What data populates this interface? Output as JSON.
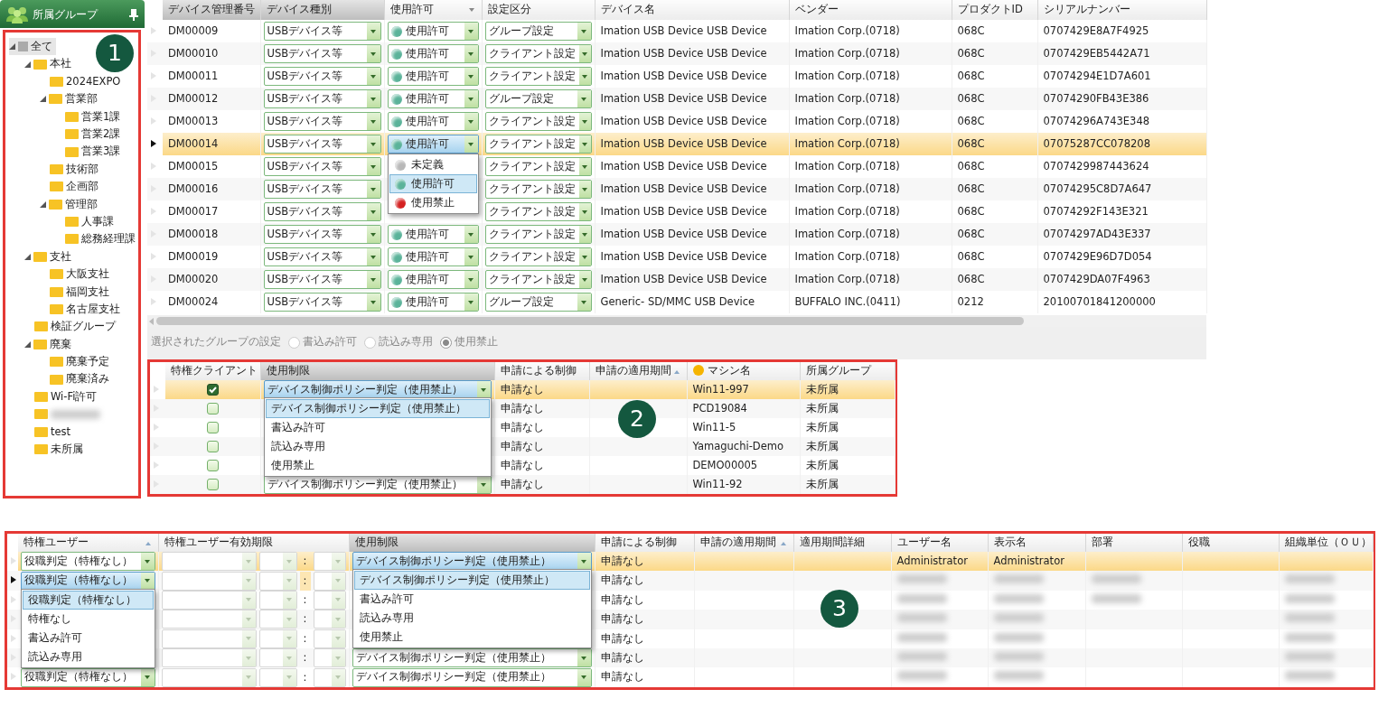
{
  "group_panel": {
    "title": "所属グループ",
    "callout": "1",
    "tree": [
      {
        "kind": "root",
        "label": "全て",
        "selected": true,
        "expanded": true,
        "children": [
          {
            "kind": "folder",
            "label": "本社",
            "expanded": true,
            "children": [
              {
                "kind": "folder",
                "label": "2024EXPO"
              },
              {
                "kind": "folder",
                "label": "営業部",
                "expanded": true,
                "children": [
                  {
                    "kind": "folder",
                    "label": "営業1課"
                  },
                  {
                    "kind": "folder",
                    "label": "営業2課"
                  },
                  {
                    "kind": "folder",
                    "label": "営業3課"
                  }
                ]
              },
              {
                "kind": "folder",
                "label": "技術部"
              },
              {
                "kind": "folder",
                "label": "企画部"
              },
              {
                "kind": "folder",
                "label": "管理部",
                "expanded": true,
                "children": [
                  {
                    "kind": "folder",
                    "label": "人事課"
                  },
                  {
                    "kind": "folder",
                    "label": "総務経理課"
                  }
                ]
              }
            ]
          },
          {
            "kind": "folder",
            "label": "支社",
            "expanded": true,
            "children": [
              {
                "kind": "folder",
                "label": "大阪支社"
              },
              {
                "kind": "folder",
                "label": "福岡支社"
              },
              {
                "kind": "folder",
                "label": "名古屋支社"
              }
            ]
          },
          {
            "kind": "folder",
            "label": "検証グループ"
          },
          {
            "kind": "folder",
            "label": "廃棄",
            "expanded": true,
            "children": [
              {
                "kind": "folder",
                "label": "廃棄予定"
              },
              {
                "kind": "folder",
                "label": "廃棄済み"
              }
            ]
          },
          {
            "kind": "folder",
            "label": "Wi-Fi許可"
          },
          {
            "kind": "folder",
            "redacted": true
          },
          {
            "kind": "folder",
            "label": "test"
          },
          {
            "kind": "folder",
            "label": "未所属"
          }
        ]
      }
    ]
  },
  "device_grid": {
    "columns": [
      {
        "label": "デバイス管理番号",
        "kind": "text",
        "editable": true
      },
      {
        "label": "デバイス種別",
        "kind": "combo",
        "editable": true
      },
      {
        "label": "使用許可",
        "kind": "status",
        "sorted": true,
        "descending": true
      },
      {
        "label": "設定区分",
        "kind": "combo"
      },
      {
        "label": "デバイス名",
        "kind": "text"
      },
      {
        "label": "ベンダー",
        "kind": "text"
      },
      {
        "label": "プロダクトID",
        "kind": "text"
      },
      {
        "label": "シリアルナンバー",
        "kind": "text"
      }
    ],
    "rows": [
      {
        "selected": false,
        "current": false,
        "cells": [
          "DM00009",
          "USBデバイス等",
          {
            "value": "使用許可",
            "color": "#5bb39a"
          },
          "グループ設定",
          "Imation USB Device USB Device",
          "Imation Corp.(0718)",
          "068C",
          "0707429E8A7F4925"
        ]
      },
      {
        "selected": false,
        "current": false,
        "cells": [
          "DM00010",
          "USBデバイス等",
          {
            "value": "使用許可",
            "color": "#5bb39a"
          },
          "クライアント設定",
          "Imation USB Device USB Device",
          "Imation Corp.(0718)",
          "068C",
          "0707429EB5442A71"
        ]
      },
      {
        "selected": false,
        "current": false,
        "cells": [
          "DM00011",
          "USBデバイス等",
          {
            "value": "使用許可",
            "color": "#5bb39a"
          },
          "クライアント設定",
          "Imation USB Device USB Device",
          "Imation Corp.(0718)",
          "068C",
          "07074294E1D7A601"
        ]
      },
      {
        "selected": false,
        "current": false,
        "cells": [
          "DM00012",
          "USBデバイス等",
          {
            "value": "使用許可",
            "color": "#5bb39a"
          },
          "グループ設定",
          "Imation USB Device USB Device",
          "Imation Corp.(0718)",
          "068C",
          "07074290FB43E386"
        ]
      },
      {
        "selected": false,
        "current": false,
        "cells": [
          "DM00013",
          "USBデバイス等",
          {
            "value": "使用許可",
            "color": "#5bb39a"
          },
          "クライアント設定",
          "Imation USB Device USB Device",
          "Imation Corp.(0718)",
          "068C",
          "07074296A743E348"
        ]
      },
      {
        "selected": true,
        "current": true,
        "cells": [
          "DM00014",
          "USBデバイス等",
          {
            "value": "使用許可",
            "color": "#5bb39a",
            "focused": true,
            "options": [
              {
                "label": "未定義",
                "color": "#b8b8b8",
                "selected": false
              },
              {
                "label": "使用許可",
                "color": "#5bb39a",
                "selected": true
              },
              {
                "label": "使用禁止",
                "color": "#d42020",
                "selected": false
              }
            ]
          },
          "クライアント設定",
          "Imation USB Device USB Device",
          "Imation Corp.(0718)",
          "068C",
          "07075287CC078208"
        ]
      },
      {
        "selected": false,
        "current": false,
        "cells": [
          "DM00015",
          "USBデバイス等",
          null,
          "クライアント設定",
          "Imation USB Device USB Device",
          "Imation Corp.(0718)",
          "068C",
          "0707429987443624"
        ]
      },
      {
        "selected": false,
        "current": false,
        "cells": [
          "DM00016",
          "USBデバイス等",
          null,
          "クライアント設定",
          "Imation USB Device USB Device",
          "Imation Corp.(0718)",
          "068C",
          "07074295C8D7A647"
        ]
      },
      {
        "selected": false,
        "current": false,
        "cells": [
          "DM00017",
          "USBデバイス等",
          null,
          "クライアント設定",
          "Imation USB Device USB Device",
          "Imation Corp.(0718)",
          "068C",
          "07074292F143E321"
        ]
      },
      {
        "selected": false,
        "current": false,
        "cells": [
          "DM00018",
          "USBデバイス等",
          {
            "value": "使用許可",
            "color": "#5bb39a"
          },
          "クライアント設定",
          "Imation USB Device USB Device",
          "Imation Corp.(0718)",
          "068C",
          "07074297AD43E337"
        ]
      },
      {
        "selected": false,
        "current": false,
        "cells": [
          "DM00019",
          "USBデバイス等",
          {
            "value": "使用許可",
            "color": "#5bb39a"
          },
          "クライアント設定",
          "Imation USB Device USB Device",
          "Imation Corp.(0718)",
          "068C",
          "0707429E96D7D054"
        ]
      },
      {
        "selected": false,
        "current": false,
        "cells": [
          "DM00020",
          "USBデバイス等",
          {
            "value": "使用許可",
            "color": "#5bb39a"
          },
          "クライアント設定",
          "Imation USB Device USB Device",
          "Imation Corp.(0718)",
          "068C",
          "0707429DA07F4963"
        ]
      },
      {
        "selected": false,
        "current": false,
        "cells": [
          "DM00024",
          "USBデバイス等",
          {
            "value": "使用許可",
            "color": "#5bb39a"
          },
          "グループ設定",
          "Generic- SD/MMC USB Device",
          "BUFFALO INC.(0411)",
          "0212",
          "20100701841200000"
        ]
      }
    ]
  },
  "group_setting": {
    "label": "選択されたグループの設定",
    "disabled": true,
    "options": [
      {
        "label": "書込み許可",
        "selected": false
      },
      {
        "label": "読込み専用",
        "selected": false
      },
      {
        "label": "使用禁止",
        "selected": true
      }
    ]
  },
  "client_grid": {
    "callout": "2",
    "columns": [
      {
        "label": "特権クライアント",
        "kind": "check"
      },
      {
        "label": "使用制限",
        "kind": "combo",
        "editable": true
      },
      {
        "label": "申請による制御",
        "kind": "text"
      },
      {
        "label": "申請の適用期間",
        "kind": "text",
        "sorted": true,
        "descending": false
      },
      {
        "label": "マシン名",
        "kind": "text",
        "flagged": true
      },
      {
        "label": "所属グループ",
        "kind": "text"
      }
    ],
    "rows": [
      {
        "selected": true,
        "current": false,
        "cells": [
          true,
          {
            "value": "デバイス制御ポリシー判定（使用禁止）",
            "focused": true,
            "options": [
              {
                "label": "デバイス制御ポリシー判定（使用禁止）",
                "selected": true
              },
              {
                "label": "書込み許可",
                "selected": false
              },
              {
                "label": "読込み専用",
                "selected": false
              },
              {
                "label": "使用禁止",
                "selected": false
              }
            ]
          },
          "申請なし",
          null,
          "Win11-997",
          "未所属"
        ]
      },
      {
        "selected": false,
        "current": false,
        "cells": [
          false,
          null,
          "申請なし",
          null,
          "PCD19084",
          "未所属"
        ]
      },
      {
        "selected": false,
        "current": false,
        "cells": [
          false,
          null,
          "申請なし",
          null,
          "Win11-5",
          "未所属"
        ]
      },
      {
        "selected": false,
        "current": false,
        "cells": [
          false,
          null,
          "申請なし",
          null,
          "Yamaguchi-Demo",
          "未所属"
        ]
      },
      {
        "selected": false,
        "current": false,
        "cells": [
          false,
          null,
          "申請なし",
          null,
          "DEMO00005",
          "未所属"
        ]
      },
      {
        "selected": false,
        "current": false,
        "cells": [
          false,
          "デバイス制御ポリシー判定（使用禁止）",
          "申請なし",
          null,
          "Win11-92",
          "未所属"
        ]
      }
    ]
  },
  "user_grid": {
    "callout": "3",
    "columns": [
      {
        "label": "特権ユーザー",
        "kind": "combo",
        "sorted": true,
        "descending": false
      },
      {
        "label": "特権ユーザー有効期限",
        "kind": "expiry"
      },
      {
        "label": "使用制限",
        "kind": "combo",
        "editable": true
      },
      {
        "label": "申請による制御",
        "kind": "text"
      },
      {
        "label": "申請の適用期間",
        "kind": "text",
        "sorted": true,
        "descending": false
      },
      {
        "label": "適用期間詳細",
        "kind": "text"
      },
      {
        "label": "ユーザー名",
        "kind": "text"
      },
      {
        "label": "表示名",
        "kind": "text"
      },
      {
        "label": "部署",
        "kind": "text"
      },
      {
        "label": "役職",
        "kind": "text"
      },
      {
        "label": "組織単位（ＯＵ）",
        "kind": "text"
      }
    ],
    "rows": [
      {
        "selected": true,
        "current": false,
        "cells": [
          "役職判定（特権なし）",
          {
            "separator": ":",
            "separator_focused": false
          },
          {
            "value": "デバイス制御ポリシー判定（使用禁止）",
            "focused": true,
            "options": [
              {
                "label": "デバイス制御ポリシー判定（使用禁止）",
                "selected": true
              },
              {
                "label": "書込み許可",
                "selected": false
              },
              {
                "label": "読込み専用",
                "selected": false
              },
              {
                "label": "使用禁止",
                "selected": false
              }
            ]
          },
          "申請なし",
          null,
          null,
          "Administrator",
          "Administrator",
          null,
          null,
          null
        ]
      },
      {
        "selected": false,
        "current": true,
        "cells": [
          {
            "value": "役職判定（特権なし）",
            "focused": true,
            "options": [
              {
                "label": "役職判定（特権なし）",
                "selected": true
              },
              {
                "label": "特権なし",
                "selected": false
              },
              {
                "label": "書込み許可",
                "selected": false
              },
              {
                "label": "読込み専用",
                "selected": false
              }
            ]
          },
          {
            "separator": ":",
            "separator_focused": true
          },
          null,
          "申請なし",
          null,
          null,
          {
            "redacted": true
          },
          {
            "redacted": true
          },
          {
            "redacted": true
          },
          null,
          {
            "redacted": true
          }
        ]
      },
      {
        "selected": false,
        "current": false,
        "cells": [
          null,
          {
            "separator": ":",
            "separator_focused": false
          },
          null,
          "申請なし",
          null,
          null,
          {
            "redacted": true
          },
          {
            "redacted": true
          },
          {
            "redacted": true
          },
          null,
          {
            "redacted": true
          }
        ]
      },
      {
        "selected": false,
        "current": false,
        "cells": [
          null,
          {
            "separator": ":",
            "separator_focused": false
          },
          null,
          "申請なし",
          null,
          null,
          {
            "redacted": true
          },
          {
            "redacted": true
          },
          null,
          null,
          {
            "redacted": true
          }
        ]
      },
      {
        "selected": false,
        "current": false,
        "cells": [
          null,
          {
            "separator": ":",
            "separator_focused": false
          },
          null,
          "申請なし",
          null,
          null,
          {
            "redacted": true
          },
          {
            "redacted": true
          },
          null,
          null,
          {
            "redacted": true
          }
        ]
      },
      {
        "selected": false,
        "current": false,
        "cells": [
          null,
          {
            "separator": ":",
            "separator_focused": false
          },
          "デバイス制御ポリシー判定（使用禁止）",
          "申請なし",
          null,
          null,
          {
            "redacted": true
          },
          {
            "redacted": true
          },
          null,
          null,
          {
            "redacted": true
          }
        ]
      },
      {
        "selected": false,
        "current": false,
        "cells": [
          "役職判定（特権なし）",
          {
            "separator": ":",
            "separator_focused": false
          },
          "デバイス制御ポリシー判定（使用禁止）",
          "申請なし",
          null,
          null,
          {
            "redacted": true
          },
          {
            "redacted": true
          },
          null,
          null,
          {
            "redacted": true
          }
        ]
      }
    ]
  }
}
